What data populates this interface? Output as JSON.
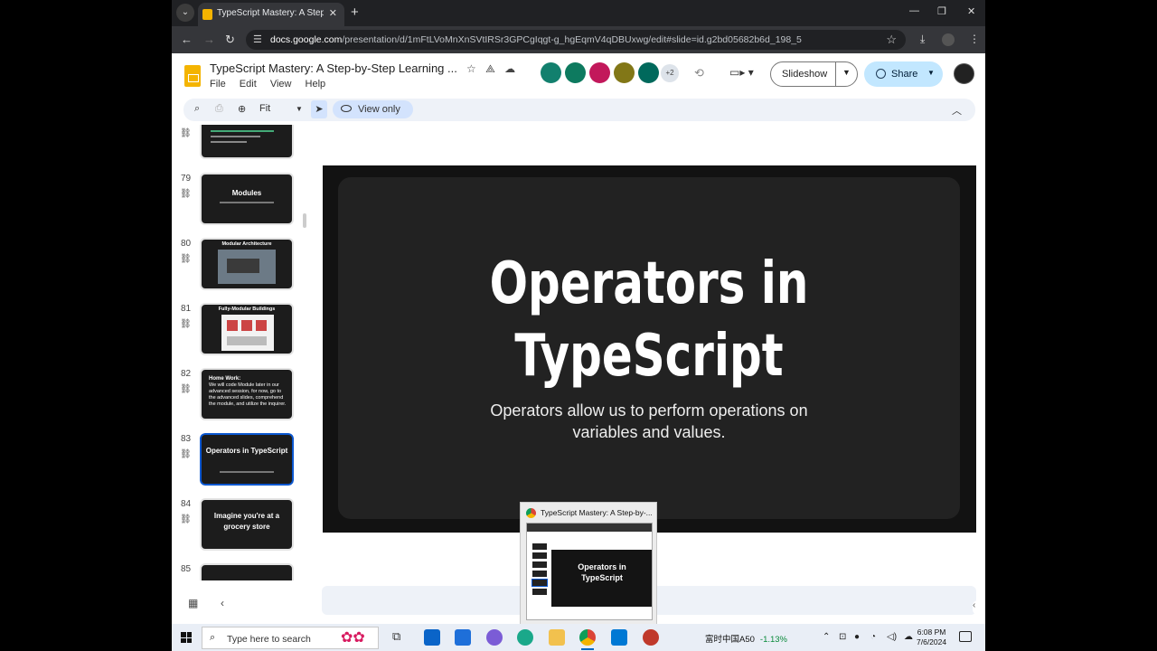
{
  "browser": {
    "tab_title": "TypeScript Mastery: A Step-by-",
    "url_domain": "docs.google.com",
    "url_path": "/presentation/d/1mFtLVoMnXnSVtIRSr3GPCgIqgt-g_hgEqmV4qDBUxwg/edit#slide=id.g2bd05682b6d_198_5"
  },
  "doc": {
    "title": "TypeScript Mastery: A Step-by-Step Learning ...",
    "menu": [
      "File",
      "Edit",
      "View",
      "Help"
    ],
    "extra_users": "+2",
    "slideshow_label": "Slideshow",
    "share_label": "Share"
  },
  "toolbar": {
    "zoom": "Fit",
    "view_only": "View only"
  },
  "filmstrip": [
    {
      "num": "79",
      "title": "Modules"
    },
    {
      "num": "80",
      "title": "Modular Architecture"
    },
    {
      "num": "81",
      "title": "Fully-Modular Buildings"
    },
    {
      "num": "82",
      "head": "Home Work:",
      "body": "We will code Module later in our advanced session, for now, go to the advanced slides, comprehend the module, and utilize the inquirer."
    },
    {
      "num": "83",
      "title": "Operators in TypeScript"
    },
    {
      "num": "84",
      "title": "Imagine you're at a grocery store"
    },
    {
      "num": "85"
    }
  ],
  "slide": {
    "title": "Operators in TypeScript",
    "subtitle": "Operators allow us to perform operations on variables and values."
  },
  "preview": {
    "title": "TypeScript Mastery: A Step-by-...",
    "slide_title": "Operators in TypeScript"
  },
  "taskbar": {
    "search_placeholder": "Type here to search",
    "stock_name": "富时中国A50",
    "stock_change": "-1.13%",
    "time": "6:08 PM",
    "date": "7/6/2024"
  },
  "colors": {
    "accent": "#0b57d0",
    "slide_bg": "#121212",
    "share_bg": "#c2e7ff"
  }
}
